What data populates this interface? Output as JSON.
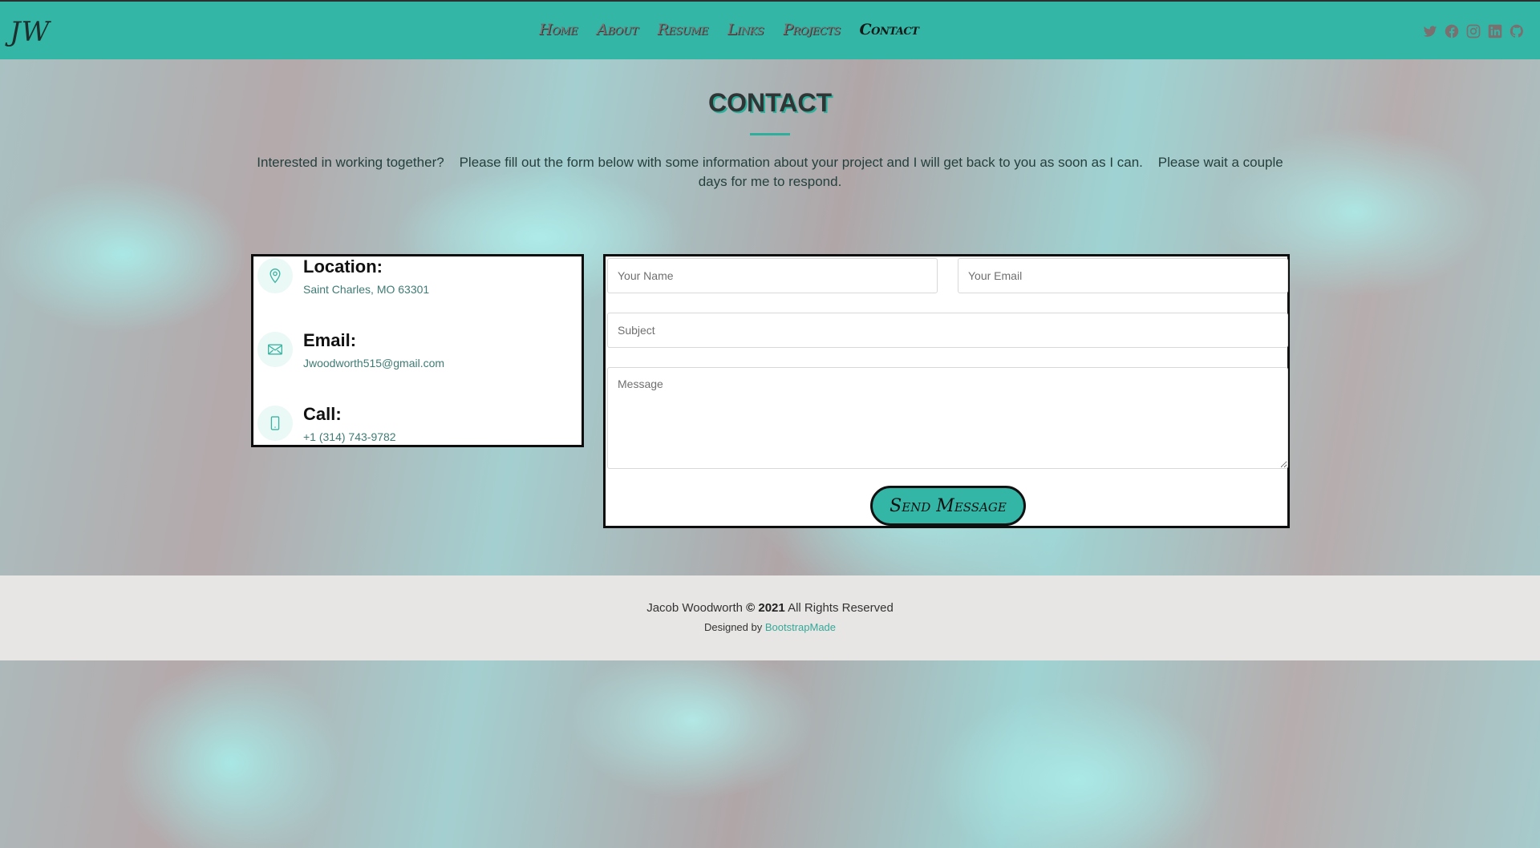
{
  "header": {
    "logo": "JW",
    "nav": [
      {
        "label": "Home",
        "active": false
      },
      {
        "label": "About",
        "active": false
      },
      {
        "label": "Resume",
        "active": false
      },
      {
        "label": "Links",
        "active": false
      },
      {
        "label": "Projects",
        "active": false
      },
      {
        "label": "Contact",
        "active": true
      }
    ],
    "social": [
      "twitter-icon",
      "facebook-icon",
      "instagram-icon",
      "linkedin-icon",
      "github-icon"
    ]
  },
  "section": {
    "title": "CONTACT",
    "intro": "Interested in working together?    Please fill out the form below with some information about your project and I will get back to you as soon as I can.    Please wait a couple days for me to respond."
  },
  "info": {
    "location": {
      "label": "Location:",
      "value": "Saint Charles, MO 63301",
      "icon": "map-pin-icon"
    },
    "email": {
      "label": "Email:",
      "value": "Jwoodworth515@gmail.com",
      "icon": "envelope-icon"
    },
    "call": {
      "label": "Call:",
      "value": "+1 (314) 743-9782",
      "icon": "phone-icon"
    }
  },
  "form": {
    "name_placeholder": "Your Name",
    "email_placeholder": "Your Email",
    "subject_placeholder": "Subject",
    "message_placeholder": "Message",
    "submit_label": "Send Message"
  },
  "footer": {
    "owner": "Jacob Woodworth",
    "copyright": "© 2021",
    "rights": "All Rights Reserved",
    "designed_by": "Designed by",
    "designer": "BootstrapMade"
  },
  "colors": {
    "accent": "#33b6a6",
    "footer_bg": "#e8e6e4",
    "link": "#35a898"
  }
}
